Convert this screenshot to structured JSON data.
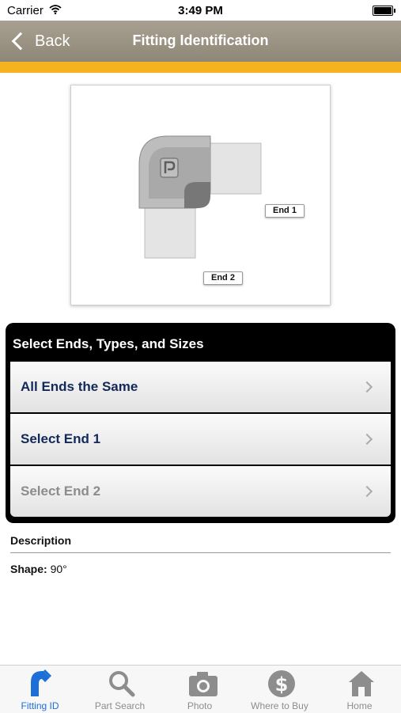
{
  "status_bar": {
    "carrier": "Carrier",
    "time": "3:49 PM"
  },
  "nav": {
    "back_label": "Back",
    "title": "Fitting Identification"
  },
  "fitting": {
    "end1_label": "End 1",
    "end2_label": "End 2"
  },
  "panel": {
    "header": "Select Ends, Types, and Sizes",
    "options": [
      {
        "label": "All Ends the Same",
        "enabled": true
      },
      {
        "label": "Select End 1",
        "enabled": true
      },
      {
        "label": "Select End 2",
        "enabled": false
      }
    ]
  },
  "description": {
    "heading": "Description",
    "shape_label": "Shape:",
    "shape_value": "90°"
  },
  "tabs": [
    {
      "label": "Fitting ID",
      "icon": "fitting-id-icon",
      "active": true
    },
    {
      "label": "Part Search",
      "icon": "search-icon",
      "active": false
    },
    {
      "label": "Photo",
      "icon": "camera-icon",
      "active": false
    },
    {
      "label": "Where to Buy",
      "icon": "dollar-icon",
      "active": false
    },
    {
      "label": "Home",
      "icon": "home-icon",
      "active": false
    }
  ],
  "colors": {
    "nav_bg": "#9a9383",
    "accent": "#f5b31f",
    "panel_bg": "#000000",
    "option_text": "#13295a",
    "tab_active": "#1d6fd8",
    "tab_inactive": "#8d8d8d"
  }
}
